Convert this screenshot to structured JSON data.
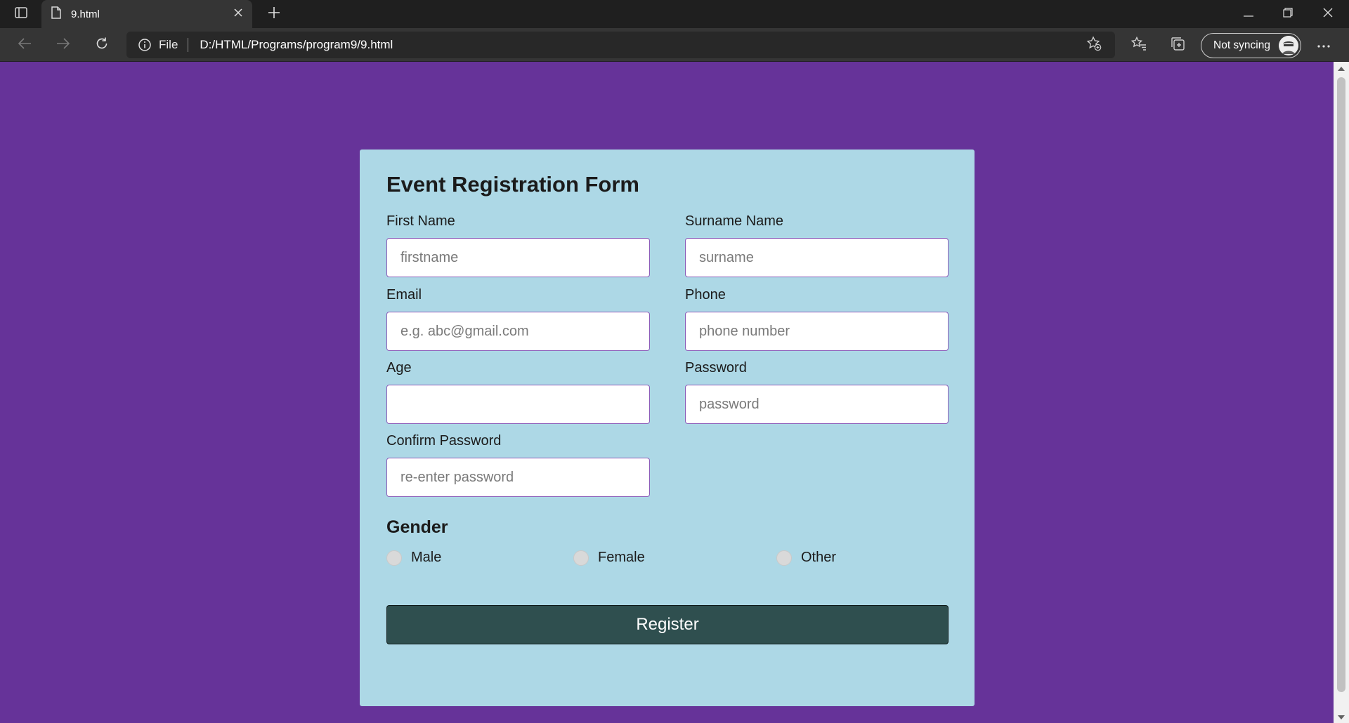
{
  "browser": {
    "tab_title": "9.html",
    "address_scheme_label": "File",
    "url": "D:/HTML/Programs/program9/9.html",
    "profile_label": "Not syncing"
  },
  "form": {
    "title": "Event Registration Form",
    "fields": {
      "first_name": {
        "label": "First Name",
        "placeholder": "firstname",
        "value": ""
      },
      "surname": {
        "label": "Surname Name",
        "placeholder": "surname",
        "value": ""
      },
      "email": {
        "label": "Email",
        "placeholder": "e.g. abc@gmail.com",
        "value": ""
      },
      "phone": {
        "label": "Phone",
        "placeholder": "phone number",
        "value": ""
      },
      "age": {
        "label": "Age",
        "placeholder": "",
        "value": ""
      },
      "password": {
        "label": "Password",
        "placeholder": "password",
        "value": ""
      },
      "confirm_password": {
        "label": "Confirm Password",
        "placeholder": "re-enter password",
        "value": ""
      }
    },
    "gender": {
      "heading": "Gender",
      "options": [
        "Male",
        "Female",
        "Other"
      ]
    },
    "submit_label": "Register"
  },
  "colors": {
    "page_background": "#663399",
    "card_background": "#add8e6",
    "button_background": "#2f4f4f"
  }
}
